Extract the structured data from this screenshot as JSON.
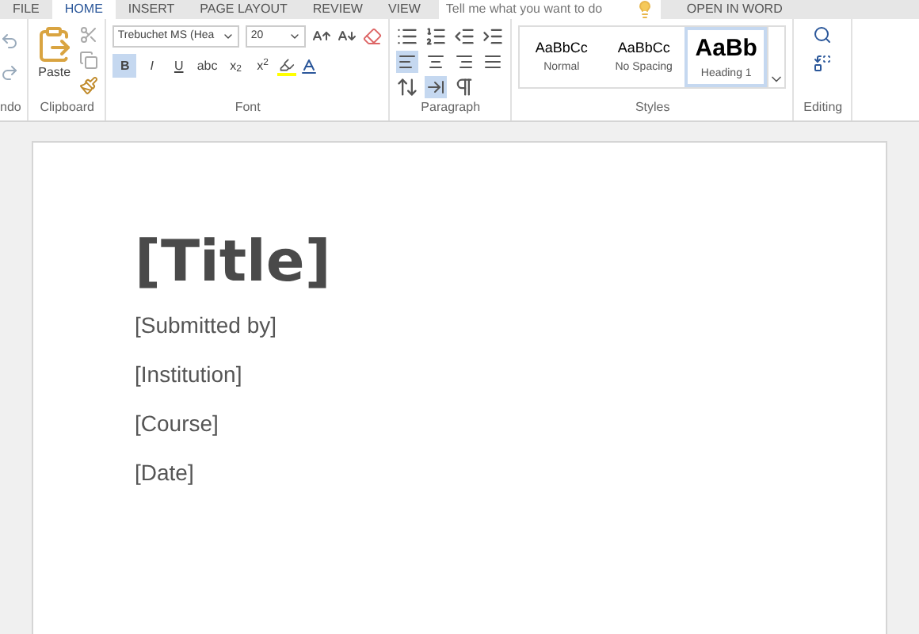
{
  "tabs": [
    {
      "label": "FILE",
      "selected": false
    },
    {
      "label": "HOME",
      "selected": true
    },
    {
      "label": "INSERT",
      "selected": false
    },
    {
      "label": "PAGE LAYOUT",
      "selected": false
    },
    {
      "label": "REVIEW",
      "selected": false
    },
    {
      "label": "VIEW",
      "selected": false
    }
  ],
  "tell_me": {
    "placeholder": "Tell me what you want to do"
  },
  "open_in_word": "OPEN IN WORD",
  "ribbon": {
    "undo_group": "ndo",
    "clipboard": {
      "paste": "Paste",
      "label": "Clipboard"
    },
    "font": {
      "name": "Trebuchet MS (Hea",
      "size": "20",
      "label": "Font",
      "format_buttons": [
        {
          "text": "B",
          "selected": true
        },
        {
          "text": "I",
          "selected": false
        },
        {
          "text": "U",
          "selected": false
        },
        {
          "text": "abc",
          "selected": false
        },
        {
          "text": "x$_{2}$",
          "selected": false
        },
        {
          "text": "x$^{2}$",
          "selected": false
        }
      ]
    },
    "paragraph": {
      "label": "Paragraph",
      "align": [
        {
          "selected": true
        },
        {
          "selected": false
        },
        {
          "selected": false
        },
        {
          "selected": false
        }
      ],
      "ltr_selected": true
    },
    "styles": {
      "label": "Styles",
      "items": [
        {
          "sample": "AaBbCc",
          "name": "Normal",
          "selected": false
        },
        {
          "sample": "AaBbCc",
          "name": "No Spacing",
          "selected": false
        },
        {
          "sample": "AaBb",
          "name": "Heading 1",
          "selected": true
        }
      ]
    },
    "editing": {
      "label": "Editing"
    }
  },
  "document": {
    "title": "[Title]",
    "lines": [
      "[Submitted by]",
      "[Institution]",
      "[Course]",
      "[Date]"
    ]
  }
}
